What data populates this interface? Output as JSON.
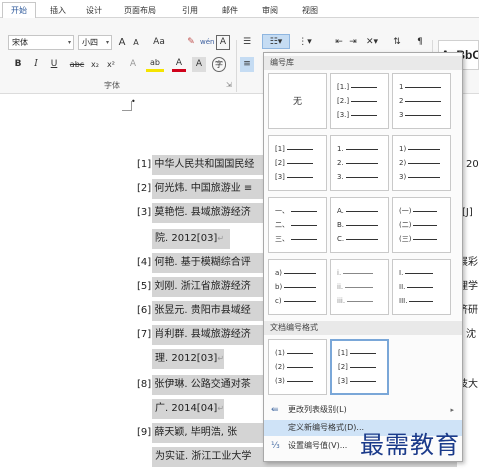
{
  "tabs": [
    "开始",
    "插入",
    "设计",
    "页面布局",
    "引用",
    "邮件",
    "审阅",
    "视图"
  ],
  "font": {
    "name": "宋体",
    "size": "小四",
    "grow": "A",
    "shrink": "A",
    "case": "Aa",
    "clear_icon": "clear-format-icon",
    "phonetic": "wén",
    "border_char": "A"
  },
  "format_row": {
    "bold": "B",
    "italic": "I",
    "underline": "U",
    "strike": "abc",
    "subscript": "x₂",
    "superscript": "x²",
    "effects": "A",
    "highlight": "ab",
    "font_color": "A",
    "shade": "A",
    "enclose": "字"
  },
  "group_label_font": "字体",
  "style_preview": "AaBbC",
  "numbering_library": {
    "title": "编号库",
    "none_label": "无",
    "tiles": [
      {
        "markers": [
          "[1.]",
          "[2.]",
          "[3.]"
        ]
      },
      {
        "markers": [
          "1",
          "2",
          "3"
        ]
      },
      {
        "markers": [
          "[1]",
          "[2]",
          "[3]"
        ]
      },
      {
        "markers": [
          "1.",
          "2.",
          "3."
        ]
      },
      {
        "markers": [
          "1)",
          "2)",
          "3)"
        ]
      },
      {
        "markers": [
          "一、",
          "二、",
          "三、"
        ]
      },
      {
        "markers": [
          "A.",
          "B.",
          "C."
        ]
      },
      {
        "markers": [
          "(一)",
          "(二)",
          "(三)"
        ]
      },
      {
        "markers": [
          "a)",
          "b)",
          "c)"
        ]
      },
      {
        "markers": [
          "i.",
          "ii.",
          "iii."
        ]
      },
      {
        "markers": [
          "I.",
          "II.",
          "III."
        ]
      }
    ]
  },
  "document_formats": {
    "title": "文档编号格式",
    "tiles": [
      {
        "markers": [
          "(1)",
          "(2)",
          "(3)"
        ]
      },
      {
        "markers": [
          "[1]",
          "[2]",
          "[3]"
        ]
      }
    ]
  },
  "menu": {
    "change_level": "更改列表级别(L)",
    "define_new": "定义新编号格式(D)...",
    "set_value": "设置编号值(V)..."
  },
  "references": [
    {
      "num": "[1]",
      "text": "中华人民共和国国民经",
      "tail": "20"
    },
    {
      "num": "[2]",
      "text": "何光炜. 中国旅游业 ≡",
      "tail": ""
    },
    {
      "num": "[3]",
      "text": "莫艳恺. 县域旅游经济",
      "tail": "[J]"
    },
    {
      "num": "",
      "text": "院. 2012[03]",
      "tail": ""
    },
    {
      "num": "[4]",
      "text": "何艳. 基于模糊综合评",
      "tail": "展彩"
    },
    {
      "num": "[5]",
      "text": "刘刚. 浙江省旅游经济",
      "tail": "理学"
    },
    {
      "num": "[6]",
      "text": "张昱元. 贵阳市县域经",
      "tail": "济研"
    },
    {
      "num": "[7]",
      "text": "肖利群. 县域旅游经济",
      "tail": "沈"
    },
    {
      "num": "",
      "text": "理. 2012[03]",
      "tail": ""
    },
    {
      "num": "[8]",
      "text": "张伊琳. 公路交通对茶",
      "tail": "技大"
    },
    {
      "num": "",
      "text": "广. 2014[04]",
      "tail": ""
    },
    {
      "num": "[9]",
      "text": "薛天颖, 毕明浩, 张",
      "tail": ""
    },
    {
      "num": "",
      "text": "为实证. 浙江工业大学",
      "tail": ""
    }
  ],
  "watermark": "最需教育"
}
